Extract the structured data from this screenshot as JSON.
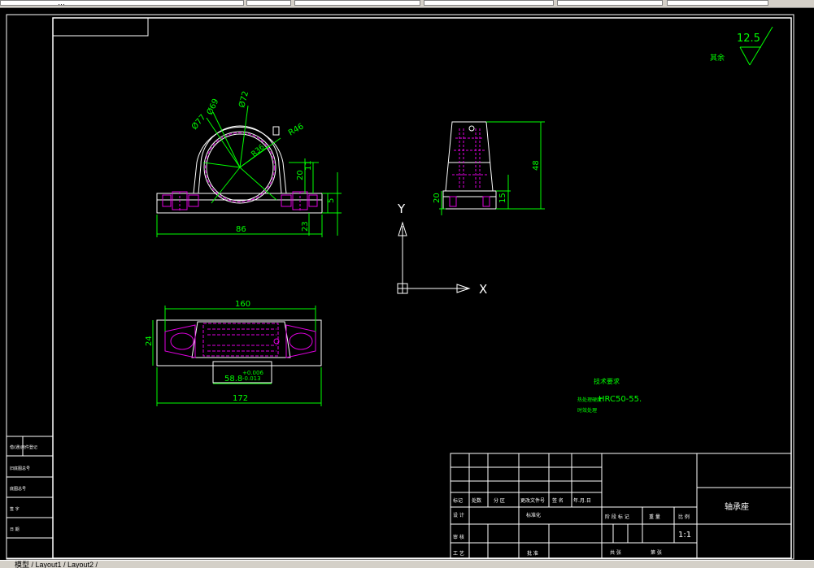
{
  "toolbar": {
    "items": [
      "…",
      "",
      "",
      "",
      ""
    ]
  },
  "drawing": {
    "roughness_value": "12.5",
    "roughness_note": "其余",
    "dimensions": {
      "phi77": "Ø77",
      "phi69": "Ø69",
      "phi72": "Ø72",
      "r46": "R46",
      "r36": "R36",
      "dim20": "20",
      "dim11": "11",
      "dim5": "5",
      "dim23": "23",
      "dim86": "86",
      "dim160": "160",
      "dim24": "24",
      "dim172": "172",
      "dim58": "58.8",
      "tol_upper": "+0.006",
      "tol_lower": "-0.013",
      "dim48": "48",
      "dim20b": "20",
      "dim15": "15"
    },
    "ucs": {
      "x": "X",
      "y": "Y"
    },
    "notes": {
      "title": "技术要求",
      "line1": "热处理硬度HRC50-55.",
      "line2_prefix": "热处理硬度",
      "line2_value": "HRC50-55.",
      "line3": "时效处理"
    }
  },
  "left_strip": {
    "rows": [
      "借(通)用件登记",
      "旧底图总号",
      "底图总号",
      "签 字",
      "日 期"
    ]
  },
  "title_block": {
    "part_name": "轴承座",
    "scale": "1:1",
    "labels": {
      "mark": "标记",
      "count": "处数",
      "zone": "分 区",
      "change_doc": "更改文件号",
      "sign": "签 名",
      "date": "年.月.日",
      "design": "设 计",
      "standardize": "标准化",
      "review": "审 核",
      "process": "工 艺",
      "approve": "批 准",
      "stage_mark": "阶 段 标 记",
      "weight": "重 量",
      "ratio": "比 例",
      "sheets_total": "共 张",
      "sheet_no": "第 张"
    }
  },
  "status": {
    "text": "模型 / Layout1 / Layout2 /"
  }
}
